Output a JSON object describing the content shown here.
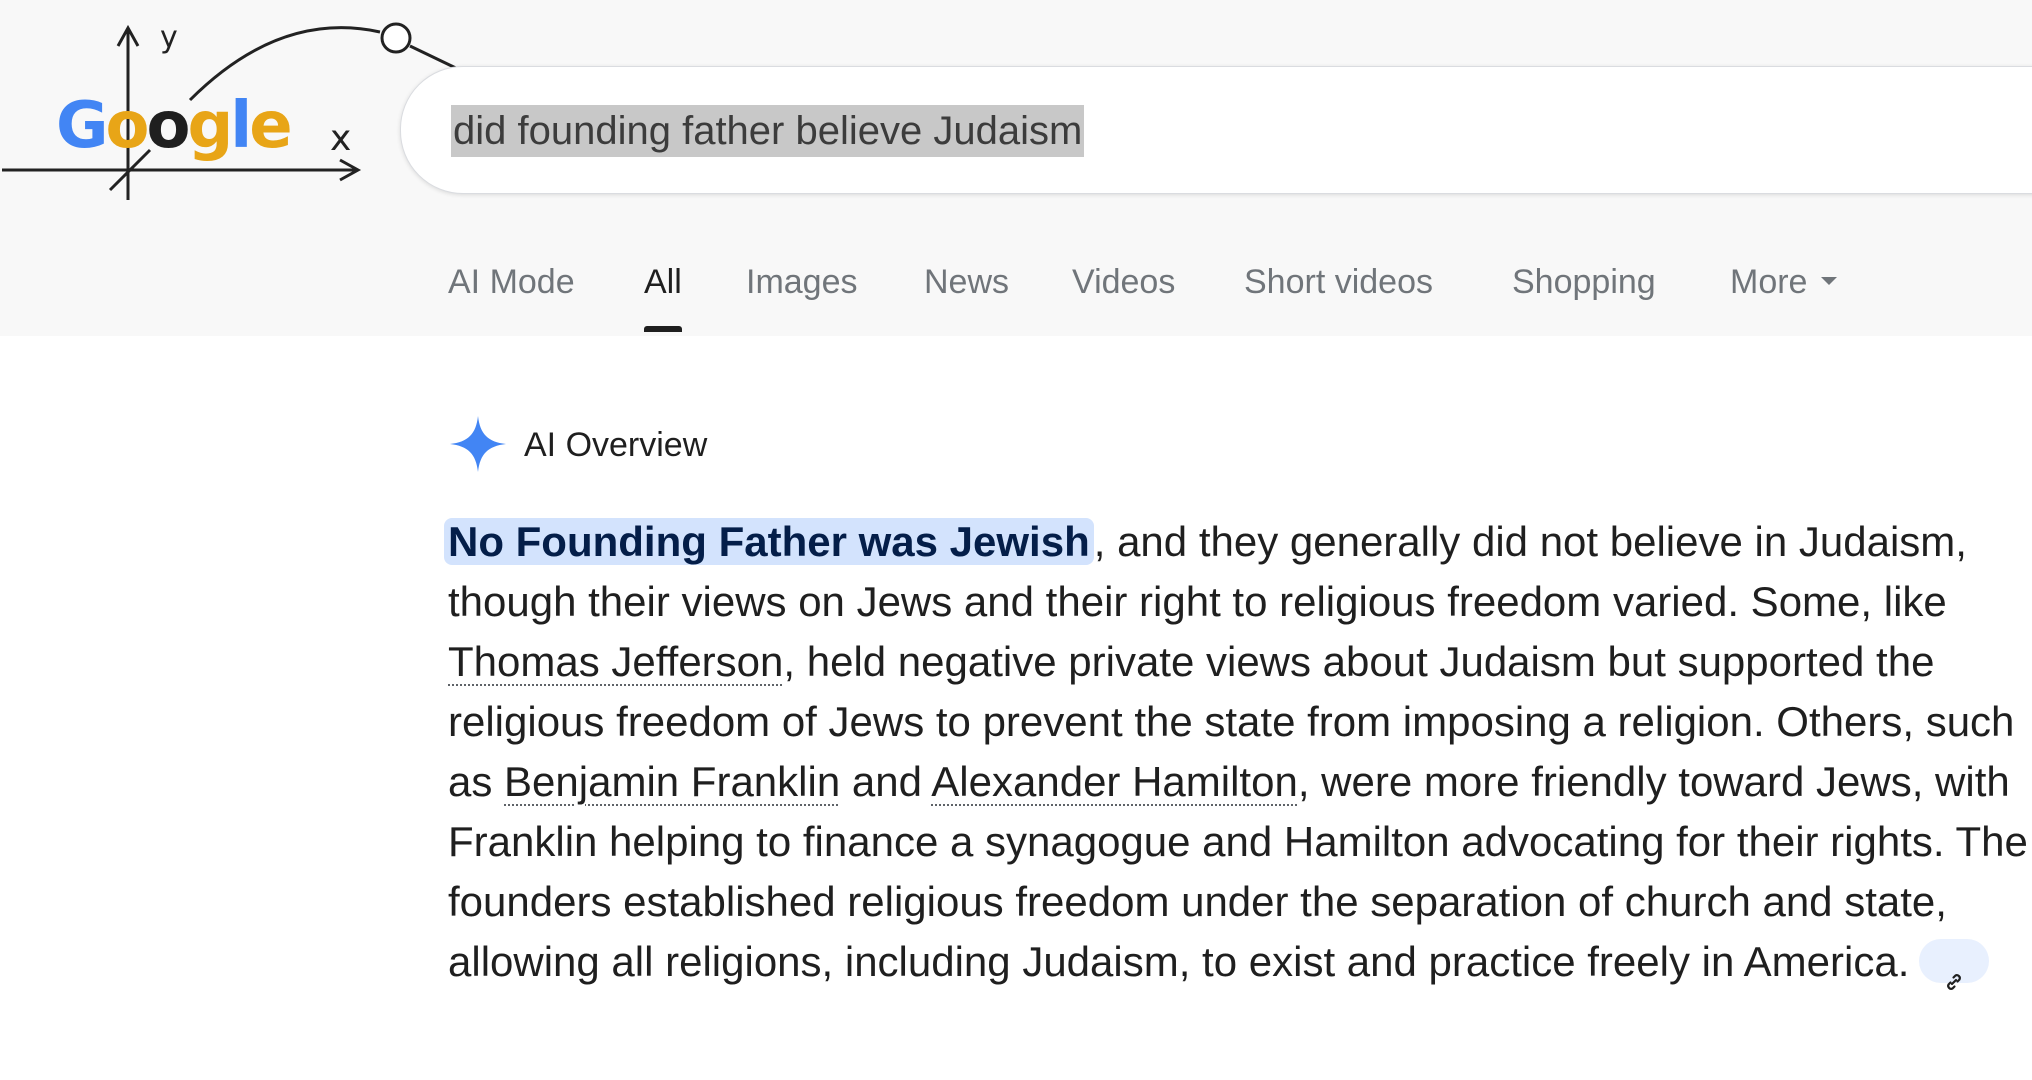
{
  "search": {
    "query": "did founding father believe Judaism"
  },
  "logo": {
    "text": "Google",
    "doodle_axis_y": "y",
    "doodle_axis_x": "x"
  },
  "tabs": [
    {
      "label": "AI Mode"
    },
    {
      "label": "All",
      "active": true
    },
    {
      "label": "Images"
    },
    {
      "label": "News"
    },
    {
      "label": "Videos"
    },
    {
      "label": "Short videos"
    },
    {
      "label": "Shopping"
    },
    {
      "label": "More"
    }
  ],
  "ai_overview": {
    "title": "AI Overview",
    "icon": "gemini-sparkle-icon",
    "highlight": "No Founding Father was Jewish",
    "text_1": ", and they generally did not believe in Judaism, though their views on Jews and their right to religious freedom varied. Some, like ",
    "entity_1": "Thomas Jefferson",
    "text_2": ", held negative private views about Judaism but supported the religious freedom of Jews to prevent the state from imposing a religion. Others, such as ",
    "entity_2": "Benjamin Franklin",
    "text_3": " and ",
    "entity_3": "Alexander Hamilton",
    "text_4": ", were more friendly toward Jews, with Franklin helping to finance a synagogue and Hamilton advocating for their rights. The founders established religious freedom under the separation of church and state, allowing all religions, including Judaism, to exist and practice freely in America.",
    "link_icon": "link-icon"
  },
  "colors": {
    "header_bg": "#f8f8f8",
    "highlight_bg": "#d3e3fd",
    "sparkle": "#4285f4",
    "query_selection": "#c8c8c8"
  }
}
